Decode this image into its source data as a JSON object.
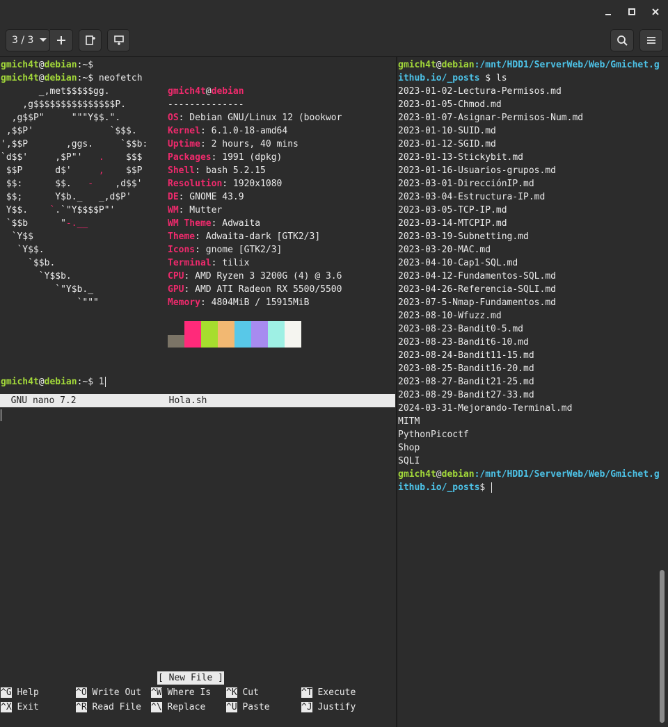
{
  "titlebar": {
    "minimize": "–",
    "maximize": "□",
    "close": "✕"
  },
  "toolbar": {
    "session_label": "3 / 3",
    "session_dropdown": "chevron-down-icon",
    "add": "+",
    "icons": [
      "plus-icon",
      "new-window-icon",
      "split-icon",
      "search-icon",
      "hamburger-menu-icon"
    ]
  },
  "left_term": {
    "user": "gmich4t",
    "at": "@",
    "host": "debian",
    "prompt_path": ":~",
    "dollar": "$",
    "cmd_neofetch": " neofetch",
    "cmd_last": " 1",
    "logo": [
      "       _,met$$$$$gg.",
      "    ,g$$$$$$$$$$$$$$$P.",
      "  ,g$$P\"     \"\"\"Y$$.\".",
      " ,$$P'              `$$$.",
      "',$$P       ,ggs.     `$$b:",
      "`d$$'     ,$P\"'   .    $$$",
      " $$P      d$'     ,    $$P",
      " $$:      $$.   -    ,d$$'",
      " $$;      Y$b._   _,d$P'",
      " Y$$.    `.`\"Y$$$$P\"'",
      " `$$b      \"-.__",
      "  `Y$$",
      "   `Y$$.",
      "     `$$b.",
      "       `Y$$b.",
      "          `\"Y$b._",
      "              `\"\"\""
    ],
    "info_header_user": "gmich4t",
    "info_header_at": "@",
    "info_header_host": "debian",
    "separator": "--------------",
    "info": [
      {
        "k": "OS",
        "v": ": Debian GNU/Linux 12 (bookwor"
      },
      {
        "k": "Kernel",
        "v": ": 6.1.0-18-amd64"
      },
      {
        "k": "Uptime",
        "v": ": 2 hours, 40 mins"
      },
      {
        "k": "Packages",
        "v": ": 1991 (dpkg)"
      },
      {
        "k": "Shell",
        "v": ": bash 5.2.15"
      },
      {
        "k": "Resolution",
        "v": ": 1920x1080"
      },
      {
        "k": "DE",
        "v": ": GNOME 43.9"
      },
      {
        "k": "WM",
        "v": ": Mutter"
      },
      {
        "k": "WM Theme",
        "v": ": Adwaita"
      },
      {
        "k": "Theme",
        "v": ": Adwaita-dark [GTK2/3]"
      },
      {
        "k": "Icons",
        "v": ": gnome [GTK2/3]"
      },
      {
        "k": "Terminal",
        "v": ": tilix"
      },
      {
        "k": "CPU",
        "v": ": AMD Ryzen 3 3200G (4) @ 3.6"
      },
      {
        "k": "GPU",
        "v": ": AMD ATI Radeon RX 5500/5500"
      },
      {
        "k": "Memory",
        "v": ": 4804MiB / 15915MiB"
      }
    ],
    "swatch_colors": [
      "#2c2c2c",
      "#7b7466",
      "#ff2a7a",
      "#a6dd2e",
      "#f2b872",
      "#58c8e8",
      "#a78bf0",
      "#9ef0e4",
      "#f5f5f0"
    ]
  },
  "nano": {
    "title": "  GNU nano 7.2                 Hola.sh",
    "message": "[ New File ]",
    "shortcuts_row1": [
      {
        "key": "^G",
        "label": " Help"
      },
      {
        "key": "^O",
        "label": " Write Out"
      },
      {
        "key": "^W",
        "label": " Where Is"
      },
      {
        "key": "^K",
        "label": " Cut"
      },
      {
        "key": "^T",
        "label": " Execute"
      }
    ],
    "shortcuts_row2": [
      {
        "key": "^X",
        "label": " Exit"
      },
      {
        "key": "^R",
        "label": " Read File"
      },
      {
        "key": "^\\",
        "label": " Replace"
      },
      {
        "key": "^U",
        "label": " Paste"
      },
      {
        "key": "^J",
        "label": " Justify"
      }
    ]
  },
  "right_term": {
    "user": "gmich4t",
    "at": "@",
    "host": "debian",
    "path1": ":/mnt/HDD1/ServerWeb/Web/Gmichet.g",
    "path2": "ithub.io/_posts",
    "cmd_ls": "$ ls",
    "dollar_end": "$ ",
    "files": [
      "2023-01-02-Lectura-Permisos.md",
      "2023-01-05-Chmod.md",
      "2023-01-07-Asignar-Permisos-Num.md",
      "2023-01-10-SUID.md",
      "2023-01-12-SGID.md",
      "2023-01-13-Stickybit.md",
      "2023-01-16-Usuarios-grupos.md",
      "2023-03-01-DirecciónIP.md",
      "2023-03-04-Estructura-IP.md",
      "2023-03-05-TCP-IP.md",
      "2023-03-14-MTCPIP.md",
      "2023-03-19-Subnetting.md",
      "2023-03-20-MAC.md",
      "2023-04-10-Cap1-SQL.md",
      "2023-04-12-Fundamentos-SQL.md",
      "2023-04-26-Referencia-SQLI.md",
      "2023-07-5-Nmap-Fundamentos.md",
      "2023-08-10-Wfuzz.md",
      "2023-08-23-Bandit0-5.md",
      "2023-08-23-Bandit6-10.md",
      "2023-08-24-Bandit11-15.md",
      "2023-08-25-Bandit16-20.md",
      "2023-08-27-Bandit21-25.md",
      "2023-08-29-Bandit27-33.md",
      "2024-03-31-Mejorando-Terminal.md",
      "MITM",
      "PythonPicoctf",
      "Shop",
      "SQLI"
    ]
  }
}
